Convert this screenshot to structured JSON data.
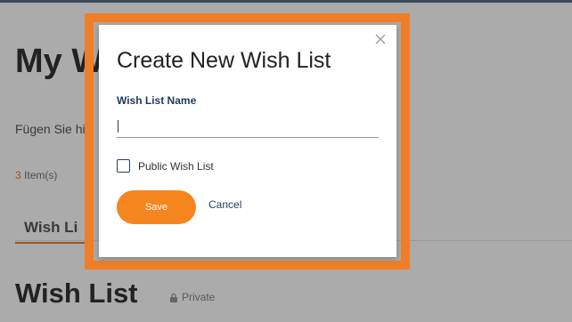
{
  "background_page": {
    "title": "My W",
    "subtitle": "Fügen Sie hi",
    "item_count_number": "3",
    "item_count_suffix": " Item(s)",
    "tab_label": "Wish Li",
    "section_title": "Wish List",
    "privacy_label": "Private",
    "privacy_icon": "lock-icon"
  },
  "modal": {
    "title": "Create New Wish List",
    "close_icon": "close-icon",
    "name_field": {
      "label": "Wish List Name",
      "value": "",
      "placeholder": ""
    },
    "public_checkbox": {
      "label": "Public Wish List",
      "checked": false
    },
    "save_label": "Save",
    "cancel_label": "Cancel"
  },
  "colors": {
    "accent_orange": "#f07e26",
    "save_button": "#f5861f",
    "label_navy": "#1f3a5a",
    "overlay": "rgba(0,0,0,0.33)"
  }
}
